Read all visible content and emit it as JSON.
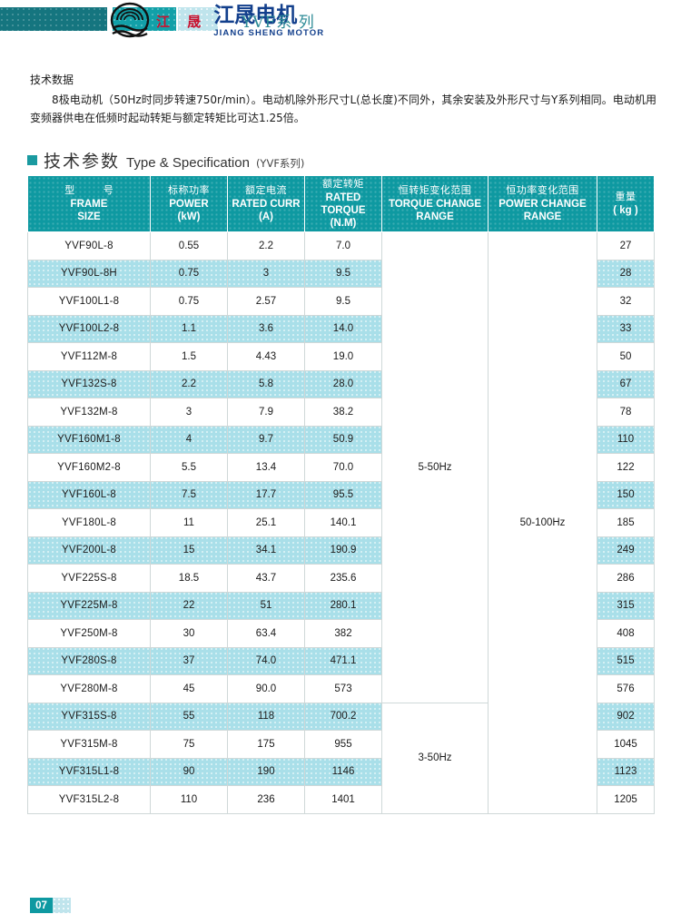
{
  "header": {
    "logo_cn_small": "江 晟",
    "logo_cn_big": "江晟电机",
    "logo_en": "JIANG SHENG MOTOR",
    "series_title": "YVF系 列"
  },
  "intro": {
    "lead": "技术数据",
    "body": "8极电动机（50Hz时同步转速750r/min）。电动机除外形尺寸L(总长度)不同外，其余安装及外形尺寸与Y系列相同。电动机用变频器供电在低频时起动转矩与额定转矩比可达1.25倍。"
  },
  "section": {
    "cn": "技术参数",
    "en": "Type & Specification",
    "sub": "(YVF系列)"
  },
  "table": {
    "columns": [
      {
        "cn": "型    号",
        "en_line1": "FRAME",
        "en_line2": "SIZE"
      },
      {
        "cn": "标称功率",
        "en_line1": "POWER",
        "en_line2": "(kW)"
      },
      {
        "cn": "额定电流",
        "en_line1": "RATED CURR",
        "en_line2": "(A)"
      },
      {
        "cn": "额定转矩",
        "en_line1": "RATED TORQUE",
        "en_line2": "(N.M)"
      },
      {
        "cn": "恒转矩变化范围",
        "en_line1": "TORQUE CHANGE",
        "en_line2": "RANGE"
      },
      {
        "cn": "恒功率变化范围",
        "en_line1": "POWER CHANGE",
        "en_line2": "RANGE"
      },
      {
        "cn": "重量",
        "en_line1": "( kg )",
        "en_line2": ""
      }
    ],
    "torque_range_1": "5-50Hz",
    "torque_range_2": "3-50Hz",
    "power_range": "50-100Hz",
    "rows": [
      {
        "frame": "YVF90L-8",
        "power": "0.55",
        "current": "2.2",
        "torque": "7.0",
        "weight": "27"
      },
      {
        "frame": "YVF90L-8H",
        "power": "0.75",
        "current": "3",
        "torque": "9.5",
        "weight": "28"
      },
      {
        "frame": "YVF100L1-8",
        "power": "0.75",
        "current": "2.57",
        "torque": "9.5",
        "weight": "32"
      },
      {
        "frame": "YVF100L2-8",
        "power": "1.1",
        "current": "3.6",
        "torque": "14.0",
        "weight": "33"
      },
      {
        "frame": "YVF112M-8",
        "power": "1.5",
        "current": "4.43",
        "torque": "19.0",
        "weight": "50"
      },
      {
        "frame": "YVF132S-8",
        "power": "2.2",
        "current": "5.8",
        "torque": "28.0",
        "weight": "67"
      },
      {
        "frame": "YVF132M-8",
        "power": "3",
        "current": "7.9",
        "torque": "38.2",
        "weight": "78"
      },
      {
        "frame": "YVF160M1-8",
        "power": "4",
        "current": "9.7",
        "torque": "50.9",
        "weight": "110"
      },
      {
        "frame": "YVF160M2-8",
        "power": "5.5",
        "current": "13.4",
        "torque": "70.0",
        "weight": "122"
      },
      {
        "frame": "YVF160L-8",
        "power": "7.5",
        "current": "17.7",
        "torque": "95.5",
        "weight": "150"
      },
      {
        "frame": "YVF180L-8",
        "power": "11",
        "current": "25.1",
        "torque": "140.1",
        "weight": "185"
      },
      {
        "frame": "YVF200L-8",
        "power": "15",
        "current": "34.1",
        "torque": "190.9",
        "weight": "249"
      },
      {
        "frame": "YVF225S-8",
        "power": "18.5",
        "current": "43.7",
        "torque": "235.6",
        "weight": "286"
      },
      {
        "frame": "YVF225M-8",
        "power": "22",
        "current": "51",
        "torque": "280.1",
        "weight": "315"
      },
      {
        "frame": "YVF250M-8",
        "power": "30",
        "current": "63.4",
        "torque": "382",
        "weight": "408"
      },
      {
        "frame": "YVF280S-8",
        "power": "37",
        "current": "74.0",
        "torque": "471.1",
        "weight": "515"
      },
      {
        "frame": "YVF280M-8",
        "power": "45",
        "current": "90.0",
        "torque": "573",
        "weight": "576"
      },
      {
        "frame": "YVF315S-8",
        "power": "55",
        "current": "118",
        "torque": "700.2",
        "weight": "902"
      },
      {
        "frame": "YVF315M-8",
        "power": "75",
        "current": "175",
        "torque": "955",
        "weight": "1045"
      },
      {
        "frame": "YVF315L1-8",
        "power": "90",
        "current": "190",
        "torque": "1146",
        "weight": "1123"
      },
      {
        "frame": "YVF315L2-8",
        "power": "110",
        "current": "236",
        "torque": "1401",
        "weight": "1205"
      }
    ]
  },
  "footer": {
    "page_number": "07"
  },
  "colors": {
    "teal": "#0e99a1",
    "dark_teal": "#15757f",
    "light_cyan": "#a9dfe9",
    "logo_blue": "#123f8c",
    "logo_red": "#c8102e"
  }
}
